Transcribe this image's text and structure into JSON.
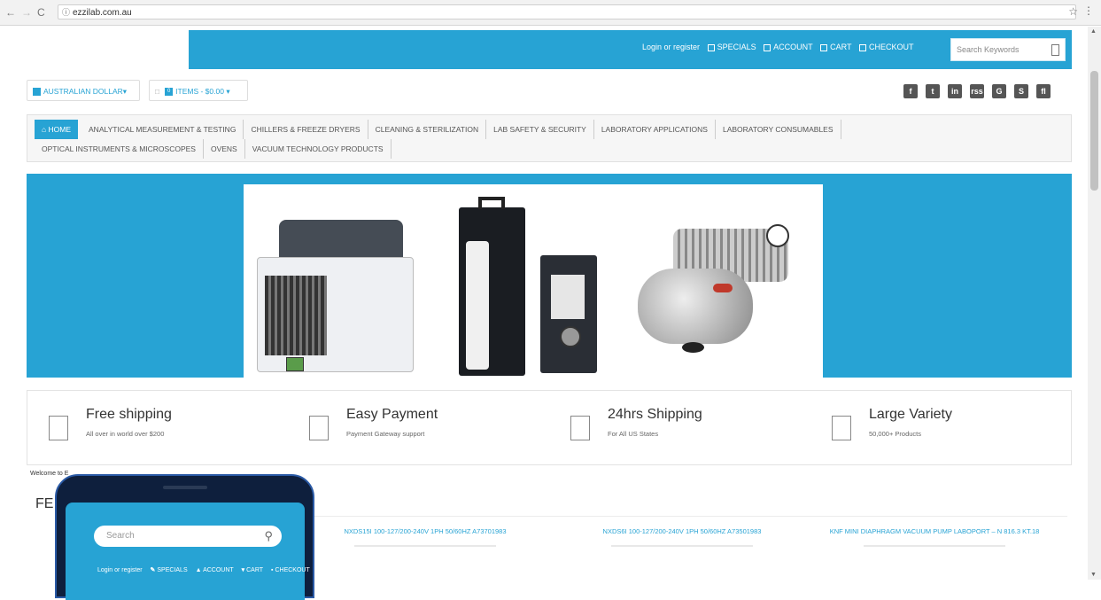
{
  "browser": {
    "url": "ezzilab.com.au",
    "back_icon": "back-arrow-icon",
    "star_icon": "star-icon"
  },
  "header": {
    "login": "Login or register",
    "links": [
      "SPECIALS",
      "ACCOUNT",
      "CART",
      "CHECKOUT"
    ],
    "search_placeholder": "Search Keywords"
  },
  "subbar": {
    "currency": "AUSTRALIAN DOLLAR",
    "cart_count": "0",
    "cart_text": "ITEMS - $0.00",
    "social": [
      "f",
      "t",
      "in",
      "rss",
      "G",
      "S",
      "fl"
    ]
  },
  "nav": {
    "row1": [
      "HOME",
      "ANALYTICAL MEASUREMENT & TESTING",
      "CHILLERS & FREEZE DRYERS",
      "CLEANING & STERILIZATION",
      "LAB SAFETY & SECURITY",
      "LABORATORY APPLICATIONS",
      "LABORATORY CONSUMABLES"
    ],
    "row2": [
      "OPTICAL INSTRUMENTS & MICROSCOPES",
      "OVENS",
      "VACUUM TECHNOLOGY PRODUCTS"
    ]
  },
  "features": [
    {
      "title": "Free shipping",
      "sub": "All over in world over $200"
    },
    {
      "title": "Easy Payment",
      "sub": "Payment Gateway support"
    },
    {
      "title": "24hrs Shipping",
      "sub": "For All US States"
    },
    {
      "title": "Large Variety",
      "sub": "50,000+ Products"
    }
  ],
  "welcome": "Welcome to E",
  "section_title": "FE",
  "products": [
    {
      "name": "NXDS15I 100-127/200-240V 1PH 50/60HZ A73701983"
    },
    {
      "name": "NXDS6I 100-127/200-240V 1PH 50/60HZ A73501983"
    },
    {
      "name": "KNF MINI DIAPHRAGM VACUUM PUMP LABOPORT – N 816.3 KT.18"
    }
  ],
  "phone": {
    "search_placeholder": "Search",
    "login": "Login or register",
    "links": [
      "SPECIALS",
      "ACCOUNT",
      "CART",
      "CHECKOUT"
    ]
  },
  "colors": {
    "accent": "#27a3d4"
  }
}
